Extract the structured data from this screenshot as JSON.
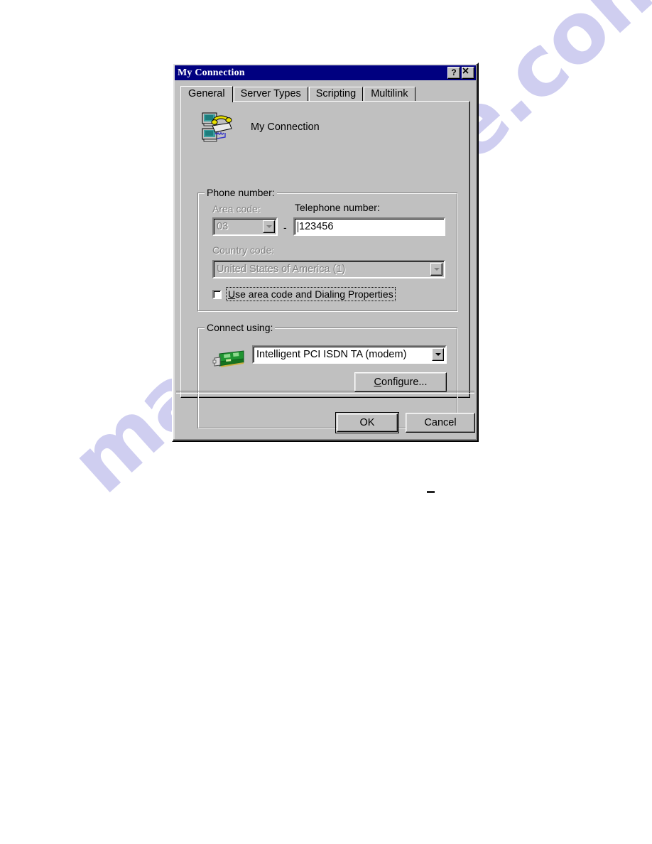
{
  "window": {
    "title": "My Connection",
    "help_button": "?",
    "close_button": "✕"
  },
  "tabs": [
    {
      "label": "General",
      "active": true
    },
    {
      "label": "Server Types",
      "active": false
    },
    {
      "label": "Scripting",
      "active": false
    },
    {
      "label": "Multilink",
      "active": false
    }
  ],
  "general": {
    "connection_name": "My Connection",
    "phone_group": {
      "title": "Phone number:",
      "area_code_label": "Area code:",
      "area_code_value": "03",
      "separator": "-",
      "telephone_label": "Telephone number:",
      "telephone_value": "123456",
      "country_code_label": "Country code:",
      "country_code_value": "United States of America (1)",
      "use_area_code_label_prefix": "U",
      "use_area_code_label_rest": "se area code and Dialing Properties",
      "use_area_code_checked": false
    },
    "connect_group": {
      "title": "Connect using:",
      "device_value": "Intelligent PCI ISDN TA (modem)",
      "configure_label_prefix": "C",
      "configure_label_rest": "onfigure..."
    }
  },
  "footer": {
    "ok_label": "OK",
    "cancel_label": "Cancel"
  },
  "watermark": {
    "text": "manualslive.com"
  },
  "colors": {
    "titlebar": "#000080",
    "face": "#c0c0c0",
    "field": "#ffffff",
    "disabled_text": "#808080",
    "watermark": "#c7c6ee"
  }
}
